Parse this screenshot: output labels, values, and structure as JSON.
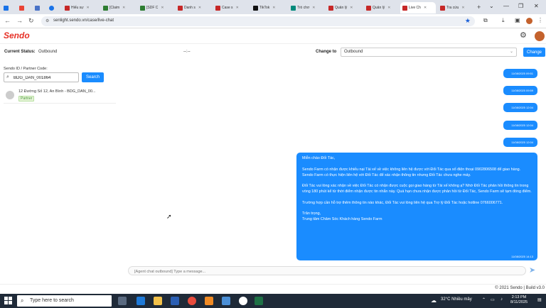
{
  "browser": {
    "tabs": [
      {
        "label": "",
        "color": "#1a73e8"
      },
      {
        "label": "",
        "color": "#ea4335"
      },
      {
        "label": "",
        "color": "#4a73c7"
      },
      {
        "label": "",
        "color": "#1a73e8"
      },
      {
        "label": "Hiếu sự",
        "color": "#c62828"
      },
      {
        "label": "[Claim",
        "color": "#2e7d32"
      },
      {
        "label": "[SDF C",
        "color": "#2e7d32"
      },
      {
        "label": "Danh s",
        "color": "#c62828"
      },
      {
        "label": "Case s",
        "color": "#c62828"
      },
      {
        "label": "TikTok",
        "color": "#111111"
      },
      {
        "label": "Trò chơ",
        "color": "#00897b"
      },
      {
        "label": "Quản lý",
        "color": "#c62828"
      },
      {
        "label": "Quản lý",
        "color": "#c62828"
      },
      {
        "label": "Live Ch",
        "color": "#c62828"
      },
      {
        "label": "Tra cứu",
        "color": "#c62828"
      }
    ],
    "url": "senlight.sendo.vn/case/live-chat"
  },
  "app": {
    "logo": "Sendo",
    "current_status_label": "Current Status:",
    "current_status_value": "Outbound",
    "timer": "--:--",
    "change_to_label": "Change to",
    "change_to_value": "Outbound",
    "change_button": "Change"
  },
  "left": {
    "field_label": "Sendo ID / Partner Code:",
    "search_value": "BDG_DAN_001864",
    "search_button": "Search",
    "case_address": "12 Đường Số 12, An Bình - BDG_DAN_00...",
    "case_tag": "Partner"
  },
  "chat": {
    "small_times": [
      "11/08/2025 09:51",
      "11/08/2025 09:59",
      "11/08/2025 12:04",
      "11/08/2025 12:04",
      "11/08/2025 12:04"
    ],
    "message_paragraphs": [
      "Miễn chào Đối Tác,",
      "Sendo Farm có nhận được khiếu nại Tài xế về việc không liên hệ được với Đối Tác qua số điện thoại 0902806508 để giao hàng. Sendo Farm có thực hiện liên hệ với Đối Tác để xác nhận thông tin nhưng Đối Tác chưa nghe máy.",
      "Đối Tác vui lòng xác nhận về việc Đối Tác có nhận được cuộc gọi giao hàng từ Tài xế không ạ? Nhờ Đối Tác phản hồi thông tin trong vòng 180 phút kể từ thời điểm nhận được tin nhắn này. Quá hạn chưa nhận được phản hồi từ Đối Tác, Sendo Farm sẽ tạm đóng điểm.",
      "Trường hợp cần hỗ trợ thêm thông tin nào khác, Đối Tác vui lòng liên hệ qua Trợ lý Đối Tác hoặc hotline 0766006771.",
      "Trân trọng,\nTrung tâm Chăm Sóc Khách hàng Sendo Farm"
    ],
    "message_time": "11/08/2025 14:13",
    "composer_placeholder": "[Agent chat outbound] Type a message..."
  },
  "footer": "© 2021 Sendo | Build v3.0",
  "taskbar": {
    "search_placeholder": "Type here to search",
    "weather": "32°C  Nhiều mây",
    "time": "2:13 PM",
    "date": "8/11/2025"
  }
}
